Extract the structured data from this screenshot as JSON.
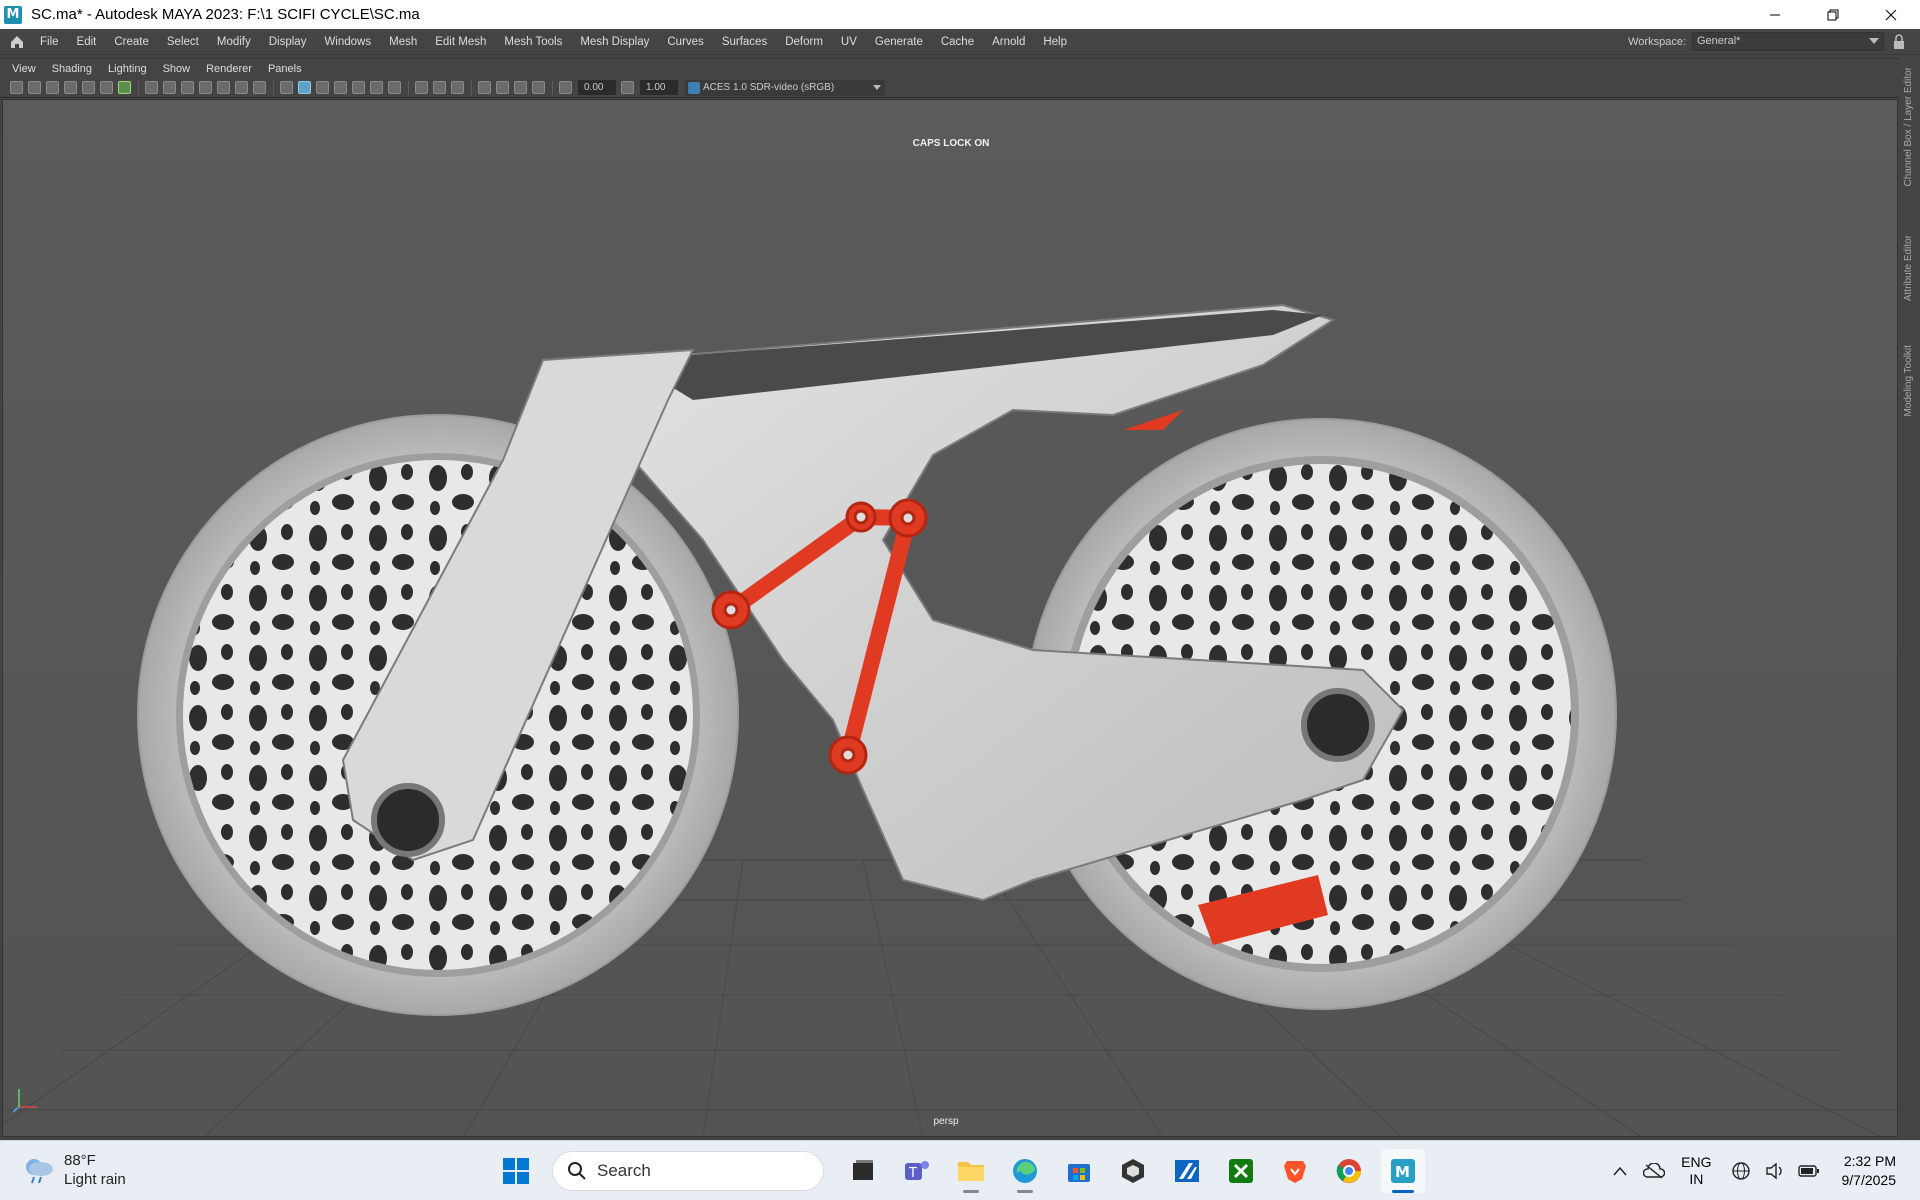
{
  "window": {
    "title": "SC.ma* - Autodesk MAYA 2023: F:\\1 SCIFI CYCLE\\SC.ma",
    "app_icon_letter": "M",
    "controls": [
      "minimize-icon",
      "restore-icon",
      "close-icon"
    ]
  },
  "menubar": {
    "items": [
      "File",
      "Edit",
      "Create",
      "Select",
      "Modify",
      "Display",
      "Windows",
      "Mesh",
      "Edit Mesh",
      "Mesh Tools",
      "Mesh Display",
      "Curves",
      "Surfaces",
      "Deform",
      "UV",
      "Generate",
      "Cache",
      "Arnold",
      "Help"
    ],
    "workspace_label": "Workspace:",
    "workspace_value": "General*"
  },
  "panel_menu": {
    "items": [
      "View",
      "Shading",
      "Lighting",
      "Show",
      "Renderer",
      "Panels"
    ]
  },
  "toolbar": {
    "exposure": "0.00",
    "gamma": "1.00",
    "color_space": "ACES 1.0 SDR-video (sRGB)"
  },
  "viewport": {
    "caps_lock_text": "CAPS LOCK ON",
    "camera_label": "persp",
    "colors": {
      "background": "#585858",
      "model_body": "#cfcfcf",
      "accent_red": "#e03a22",
      "grid_line": "#464646"
    }
  },
  "side_tabs": [
    "Channel Box / Layer Editor",
    "Attribute Editor",
    "Modeling Toolkit"
  ],
  "taskbar": {
    "weather_temp": "88°F",
    "weather_desc": "Light rain",
    "search_placeholder": "Search",
    "apps": [
      "file-explorer-icon",
      "teams-icon",
      "folder-icon",
      "edge-icon",
      "store-icon",
      "unity-icon",
      "autodesk-icon",
      "xbox-icon",
      "brave-icon",
      "chrome-icon",
      "maya-icon"
    ],
    "lang_line1": "ENG",
    "lang_line2": "IN",
    "time": "2:32 PM",
    "date": "9/7/2025"
  }
}
